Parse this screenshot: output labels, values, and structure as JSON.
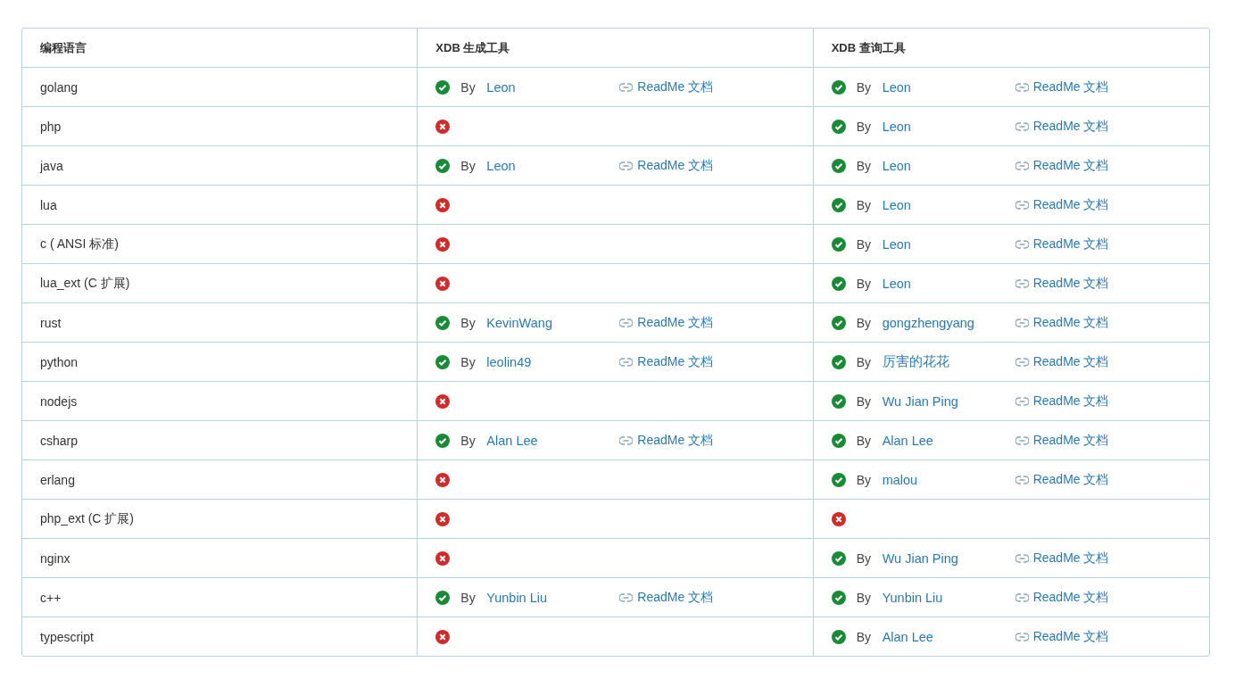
{
  "table": {
    "columns": [
      "编程语言",
      "XDB 生成工具",
      "XDB 查询工具"
    ],
    "rows": [
      {
        "language": "golang",
        "generator": {
          "supported": true,
          "by": "By",
          "author": "Leon",
          "link": "ReadMe 文档"
        },
        "query": {
          "supported": true,
          "by": "By",
          "author": "Leon",
          "link": "ReadMe 文档"
        }
      },
      {
        "language": "php",
        "generator": {
          "supported": false
        },
        "query": {
          "supported": true,
          "by": "By",
          "author": "Leon",
          "link": "ReadMe 文档"
        }
      },
      {
        "language": "java",
        "generator": {
          "supported": true,
          "by": "By",
          "author": "Leon",
          "link": "ReadMe 文档"
        },
        "query": {
          "supported": true,
          "by": "By",
          "author": "Leon",
          "link": "ReadMe 文档"
        }
      },
      {
        "language": "lua",
        "generator": {
          "supported": false
        },
        "query": {
          "supported": true,
          "by": "By",
          "author": "Leon",
          "link": "ReadMe 文档"
        }
      },
      {
        "language": "c ( ANSI 标准)",
        "generator": {
          "supported": false
        },
        "query": {
          "supported": true,
          "by": "By",
          "author": "Leon",
          "link": "ReadMe 文档"
        }
      },
      {
        "language": "lua_ext (C 扩展)",
        "generator": {
          "supported": false
        },
        "query": {
          "supported": true,
          "by": "By",
          "author": "Leon",
          "link": "ReadMe 文档"
        }
      },
      {
        "language": "rust",
        "generator": {
          "supported": true,
          "by": "By",
          "author": "KevinWang",
          "link": "ReadMe 文档"
        },
        "query": {
          "supported": true,
          "by": "By",
          "author": "gongzhengyang",
          "link": "ReadMe 文档"
        }
      },
      {
        "language": "python",
        "generator": {
          "supported": true,
          "by": "By",
          "author": "leolin49",
          "link": "ReadMe 文档"
        },
        "query": {
          "supported": true,
          "by": "By",
          "author": "厉害的花花",
          "link": "ReadMe 文档"
        }
      },
      {
        "language": "nodejs",
        "generator": {
          "supported": false
        },
        "query": {
          "supported": true,
          "by": "By",
          "author": "Wu Jian Ping",
          "link": "ReadMe 文档"
        }
      },
      {
        "language": "csharp",
        "generator": {
          "supported": true,
          "by": "By",
          "author": "Alan Lee",
          "link": "ReadMe 文档"
        },
        "query": {
          "supported": true,
          "by": "By",
          "author": "Alan Lee",
          "link": "ReadMe 文档"
        }
      },
      {
        "language": "erlang",
        "generator": {
          "supported": false
        },
        "query": {
          "supported": true,
          "by": "By",
          "author": "malou",
          "link": "ReadMe 文档"
        }
      },
      {
        "language": "php_ext (C 扩展)",
        "generator": {
          "supported": false
        },
        "query": {
          "supported": false
        }
      },
      {
        "language": "nginx",
        "generator": {
          "supported": false
        },
        "query": {
          "supported": true,
          "by": "By",
          "author": "Wu Jian Ping",
          "link": "ReadMe 文档"
        }
      },
      {
        "language": "c++",
        "generator": {
          "supported": true,
          "by": "By",
          "author": "Yunbin Liu",
          "link": "ReadMe 文档"
        },
        "query": {
          "supported": true,
          "by": "By",
          "author": "Yunbin Liu",
          "link": "ReadMe 文档"
        }
      },
      {
        "language": "typescript",
        "generator": {
          "supported": false
        },
        "query": {
          "supported": true,
          "by": "By",
          "author": "Alan Lee",
          "link": "ReadMe 文档"
        }
      }
    ]
  }
}
